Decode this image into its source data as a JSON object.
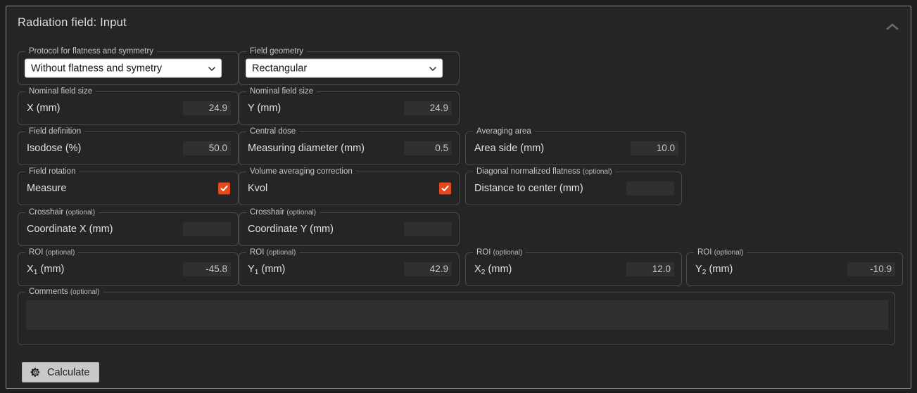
{
  "panel": {
    "title": "Radiation field: Input",
    "collapse_icon": "chevron-up-icon"
  },
  "accent_color": "#E8481E",
  "groups": {
    "protocol": {
      "legend": "Protocol for flatness and symmetry",
      "selected": "Without flatness and symetry",
      "chevron_icon": "chevron-down-icon"
    },
    "geometry": {
      "legend": "Field geometry",
      "selected": "Rectangular",
      "chevron_icon": "chevron-down-icon"
    },
    "nominal_x": {
      "legend": "Nominal field size",
      "label": "X (mm)",
      "value": "24.9"
    },
    "nominal_y": {
      "legend": "Nominal field size",
      "label": "Y (mm)",
      "value": "24.9"
    },
    "field_definition": {
      "legend": "Field definition",
      "label": "Isodose (%)",
      "value": "50.0"
    },
    "central_dose": {
      "legend": "Central dose",
      "label": "Measuring diameter (mm)",
      "value": "0.5"
    },
    "averaging_area": {
      "legend": "Averaging area",
      "label": "Area side (mm)",
      "value": "10.0"
    },
    "field_rotation": {
      "legend": "Field rotation",
      "label": "Measure",
      "checked": true,
      "check_icon": "checkmark-icon"
    },
    "volume_averaging": {
      "legend": "Volume averaging correction",
      "label": "Kvol",
      "checked": true,
      "check_icon": "checkmark-icon"
    },
    "diagonal_flatness": {
      "legend": "Diagonal normalized flatness",
      "legend_optional": "(optional)",
      "label": "Distance to center (mm)",
      "value": ""
    },
    "crosshair_x": {
      "legend": "Crosshair",
      "legend_optional": "(optional)",
      "label": "Coordinate X (mm)",
      "value": ""
    },
    "crosshair_y": {
      "legend": "Crosshair",
      "legend_optional": "(optional)",
      "label": "Coordinate Y (mm)",
      "value": ""
    },
    "roi_x1": {
      "legend": "ROI",
      "legend_optional": "(optional)",
      "label_base": "X",
      "label_sub": "1",
      "label_unit": " (mm)",
      "value": "-45.8"
    },
    "roi_y1": {
      "legend": "ROI",
      "legend_optional": "(optional)",
      "label_base": "Y",
      "label_sub": "1",
      "label_unit": " (mm)",
      "value": "42.9"
    },
    "roi_x2": {
      "legend": "ROI",
      "legend_optional": "(optional)",
      "label_base": "X",
      "label_sub": "2",
      "label_unit": " (mm)",
      "value": "12.0"
    },
    "roi_y2": {
      "legend": "ROI",
      "legend_optional": "(optional)",
      "label_base": "Y",
      "label_sub": "2",
      "label_unit": " (mm)",
      "value": "-10.9"
    },
    "comments": {
      "legend": "Comments",
      "legend_optional": "(optional)",
      "value": "",
      "placeholder": ""
    }
  },
  "actions": {
    "calculate_label": "Calculate",
    "calculate_icon": "gear-icon"
  }
}
